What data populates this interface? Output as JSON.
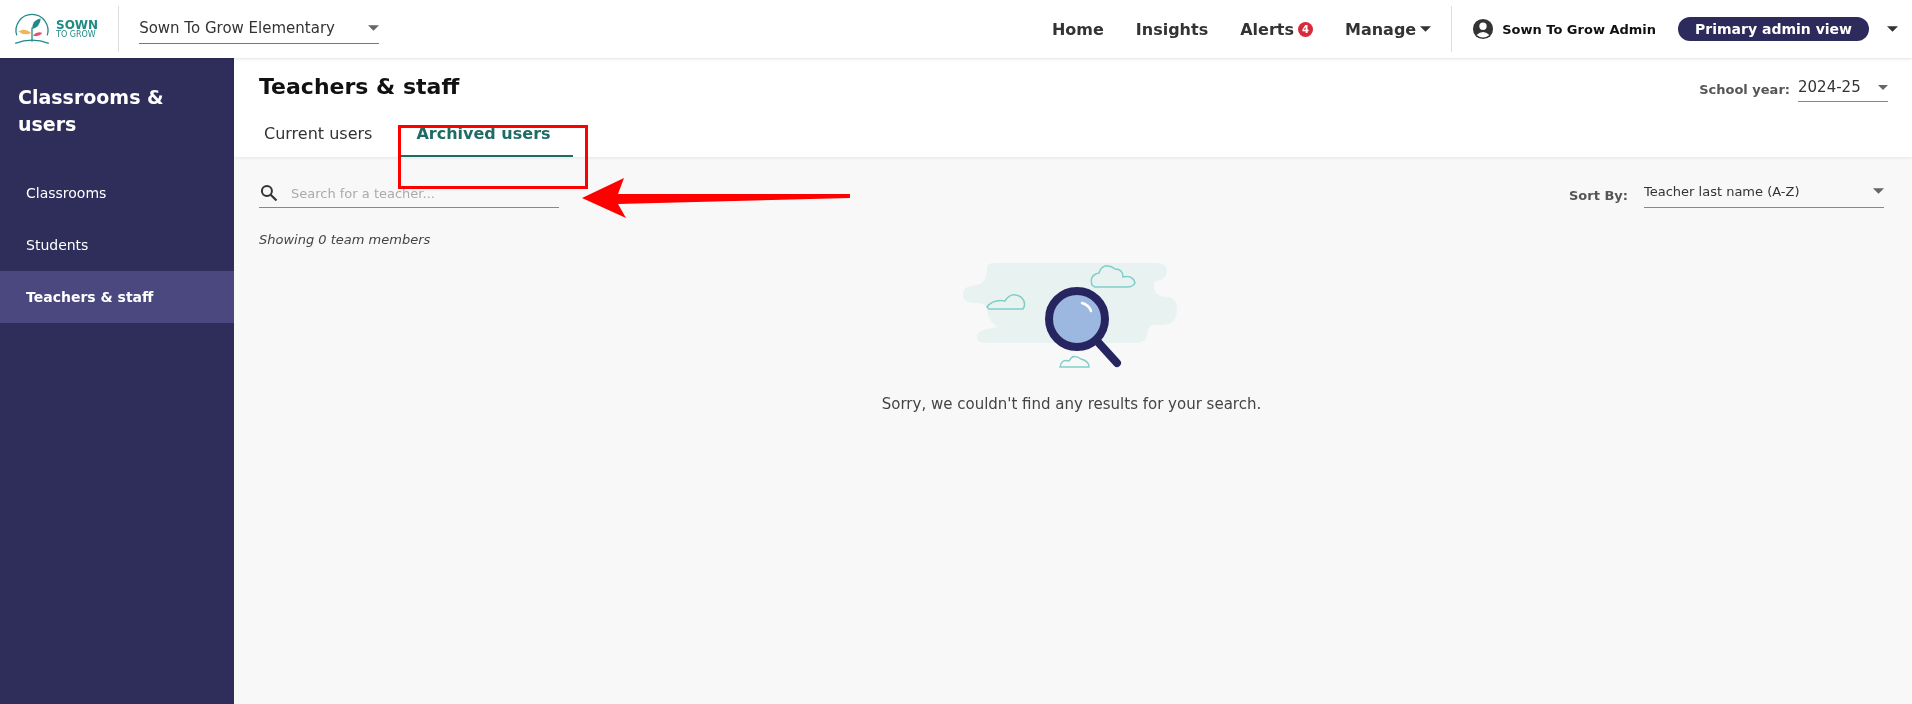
{
  "header": {
    "logo": {
      "line_1": "SOWN",
      "line_2": "TO GROW"
    },
    "school_select": {
      "value": "Sown To Grow Elementary"
    },
    "nav": [
      {
        "label": "Home",
        "kind": "link"
      },
      {
        "label": "Insights",
        "kind": "link"
      },
      {
        "label": "Alerts",
        "kind": "badge",
        "badge": "4"
      },
      {
        "label": "Manage",
        "kind": "menu"
      }
    ],
    "user": {
      "name": "Sown To Grow Admin",
      "view": "Primary admin view"
    }
  },
  "sidebar": {
    "title": "Classrooms & users",
    "items": [
      {
        "label": "Classrooms",
        "selected": false
      },
      {
        "label": "Students",
        "selected": false
      },
      {
        "label": "Teachers & staff",
        "selected": true
      }
    ]
  },
  "page": {
    "title": "Teachers & staff",
    "school_year": {
      "label": "School year:",
      "value": "2024-25"
    },
    "tabs": [
      {
        "label": "Current users",
        "selected": false
      },
      {
        "label": "Archived users",
        "selected": true
      }
    ],
    "search": {
      "placeholder": "Search for a teacher..."
    },
    "sort": {
      "label": "Sort By:",
      "value": "Teacher last name (A-Z)"
    },
    "count": "Showing 0 team members",
    "empty_message": "Sorry, we couldn't find any results for your search."
  }
}
